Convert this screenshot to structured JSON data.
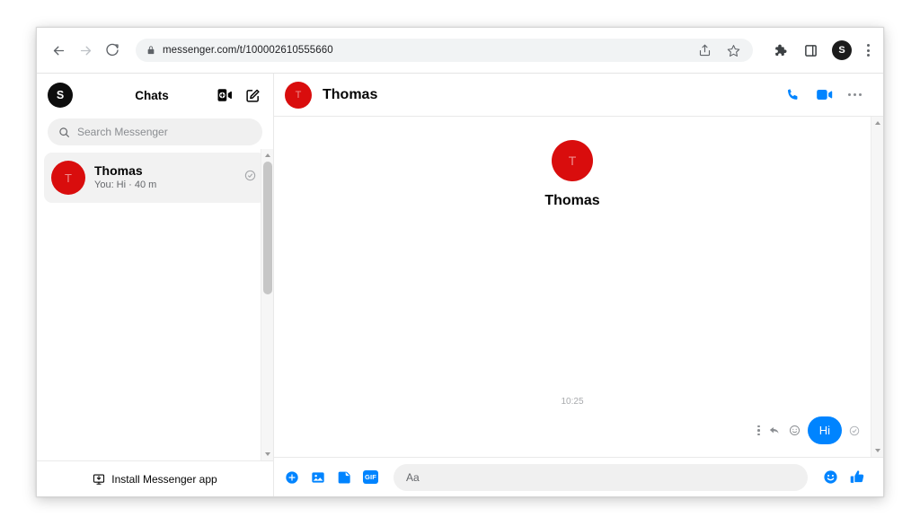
{
  "browser": {
    "url": "messenger.com/t/100002610555660",
    "back_label": "Back",
    "forward_label": "Forward",
    "reload_label": "Reload",
    "lock_icon": "lock-icon",
    "share_icon": "share-icon",
    "bookmark_icon": "star-icon",
    "extensions_icon": "puzzle-icon",
    "sidepanel_icon": "square-icon",
    "profile_initial": "S",
    "menu_label": "Customize and control"
  },
  "sidebar": {
    "avatar_initial": "S",
    "title": "Chats",
    "new_call_icon": "video-call-plus-icon",
    "compose_icon": "compose-icon",
    "search": {
      "placeholder": "Search Messenger",
      "value": "",
      "icon": "search-icon"
    },
    "chats": [
      {
        "avatar_initial": "T",
        "name": "Thomas",
        "preview": "You: Hi · 40 m",
        "status_icon": "seen-check-icon",
        "selected": true
      }
    ],
    "footer": {
      "install_label": "Install Messenger app",
      "install_icon": "monitor-download-icon"
    }
  },
  "conversation": {
    "avatar_initial": "T",
    "name": "Thomas",
    "call_icon": "phone-icon",
    "video_icon": "video-camera-icon",
    "more_icon": "more-horizontal-icon",
    "profile": {
      "avatar_initial": "T",
      "name": "Thomas"
    },
    "timestamp": "10:25",
    "messages": [
      {
        "text": "Hi",
        "outgoing": true,
        "options_icon": "more-vertical-icon",
        "reply_icon": "reply-icon",
        "react_icon": "emoji-react-icon",
        "status_icon": "delivered-check-icon"
      }
    ],
    "composer": {
      "placeholder": "Aa",
      "value": "",
      "add_icon": "plus-circle-icon",
      "photo_icon": "image-icon",
      "sticker_icon": "sticker-icon",
      "gif_icon": "GIF",
      "emoji_icon": "emoji-icon",
      "like_icon": "thumbs-up-icon"
    }
  },
  "colors": {
    "accent_blue": "#0084ff",
    "avatar_red": "#d90d0d",
    "text_primary": "#050505",
    "text_secondary": "#65676b"
  }
}
